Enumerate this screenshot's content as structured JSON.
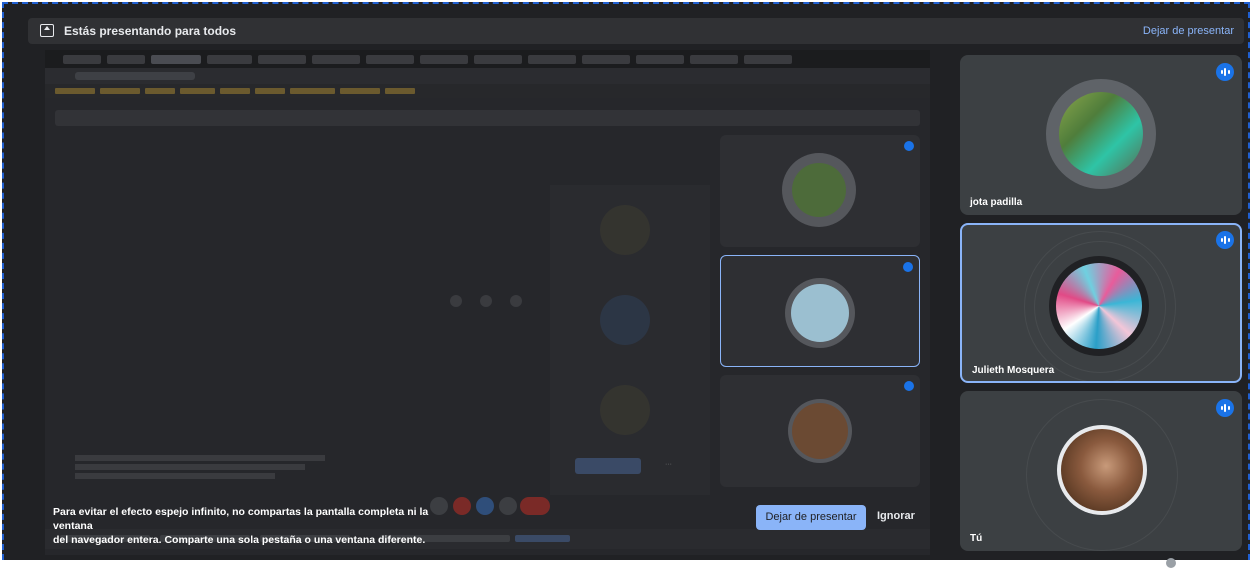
{
  "presenting_bar": {
    "title": "Estás presentando para todos",
    "stop_link": "Dejar de presentar"
  },
  "warning_banner": {
    "text_line1": "Para evitar el efecto espejo infinito, no compartas la pantalla completa ni la ventana",
    "text_line2": "del navegador entera. Comparte una sola pestaña o una ventana diferente.",
    "stop_button": "Dejar de presentar",
    "ignore_button": "Ignorar"
  },
  "participants": [
    {
      "name": "jota padilla",
      "speaking": true
    },
    {
      "name": "Julieth Mosquera",
      "speaking": true,
      "active": true
    },
    {
      "name": "Tú",
      "speaking": true
    }
  ],
  "colors": {
    "accent": "#8ab4f8",
    "badge": "#1a73e8",
    "background": "#202124",
    "tile": "#3c4043"
  }
}
